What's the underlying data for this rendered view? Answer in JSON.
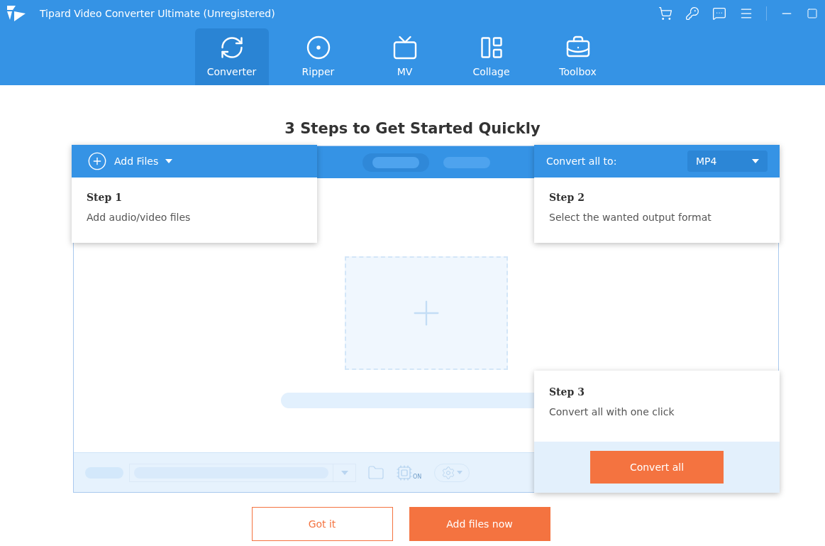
{
  "window": {
    "title": "Tipard Video Converter Ultimate (Unregistered)"
  },
  "tabs": [
    {
      "label": "Converter",
      "kind": "converter",
      "selected": true
    },
    {
      "label": "Ripper",
      "kind": "ripper",
      "selected": false
    },
    {
      "label": "MV",
      "kind": "mv",
      "selected": false
    },
    {
      "label": "Collage",
      "kind": "collage",
      "selected": false
    },
    {
      "label": "Toolbox",
      "kind": "toolbox",
      "selected": false
    }
  ],
  "heading": "3 Steps to Get Started Quickly",
  "add_files": {
    "label": "Add Files"
  },
  "convert_all_to": {
    "label": "Convert all to:",
    "value": "MP4"
  },
  "steps": [
    {
      "title": "Step 1",
      "text": "Add audio/video files"
    },
    {
      "title": "Step 2",
      "text": "Select the wanted output format"
    },
    {
      "title": "Step 3",
      "text": "Convert all with one click"
    }
  ],
  "convert_all_button": "Convert all",
  "gpu_badge": "ON",
  "buttons": [
    {
      "label": "Got it",
      "kind": "outline"
    },
    {
      "label": "Add files now",
      "kind": "filled"
    }
  ]
}
